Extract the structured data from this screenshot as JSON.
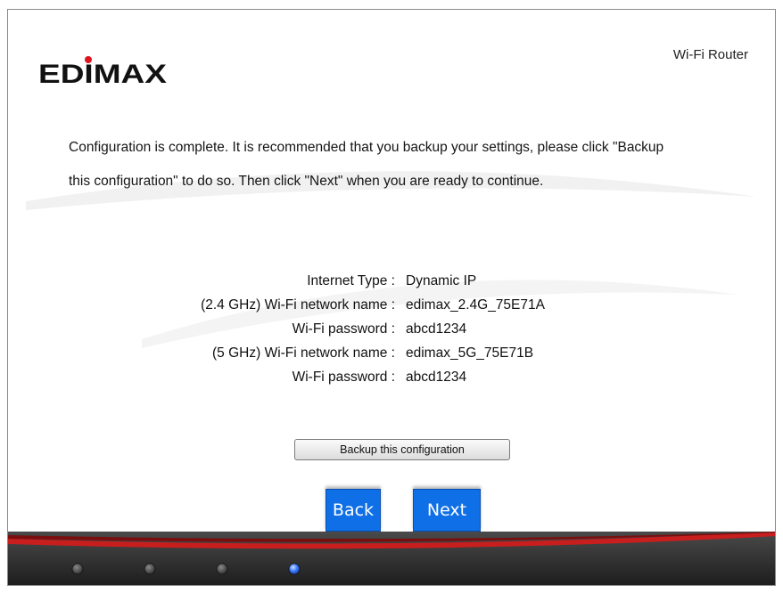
{
  "header": {
    "brand": "EDIMAX",
    "product_label": "Wi-Fi Router"
  },
  "message": {
    "line1": "Configuration is complete. It is recommended that you backup your settings, please click \"Backup",
    "line2": "this configuration\" to do so. Then click \"Next\" when you are ready to continue."
  },
  "summary": [
    {
      "label": "Internet Type :",
      "value": "Dynamic IP"
    },
    {
      "label": "(2.4 GHz) Wi-Fi network name :",
      "value": "edimax_2.4G_75E71A"
    },
    {
      "label": "Wi-Fi password :",
      "value": "abcd1234"
    },
    {
      "label": "(5 GHz) Wi-Fi network name :",
      "value": "edimax_5G_75E71B"
    },
    {
      "label": "Wi-Fi password :",
      "value": "abcd1234"
    }
  ],
  "buttons": {
    "backup_label": "Backup this configuration",
    "back_label": "Back",
    "next_label": "Next"
  },
  "steps": {
    "total": 4,
    "current": 4
  },
  "colors": {
    "nav_button": "#0f6fe6",
    "footer_bar": "#2c2c2c",
    "footer_accent": "#c81e1e",
    "active_step": "#3f7cff",
    "logo_dot": "#e0141e"
  }
}
